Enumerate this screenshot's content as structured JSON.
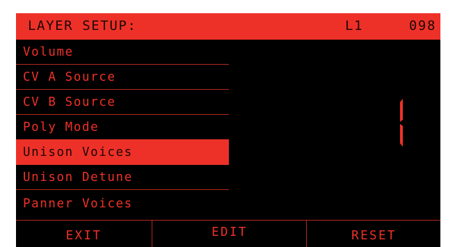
{
  "header": {
    "title": "LAYER SETUP:",
    "layer": "L1",
    "number": "098"
  },
  "menu": {
    "items": [
      {
        "label": "Volume"
      },
      {
        "label": "CV A Source"
      },
      {
        "label": "CV B Source"
      },
      {
        "label": "Poly Mode"
      },
      {
        "label": "Unison Voices"
      },
      {
        "label": "Unison Detune"
      },
      {
        "label": "Panner Voices"
      }
    ],
    "selected_index": 4
  },
  "value_display": {
    "value": "1"
  },
  "softkeys": {
    "exit": "EXIT",
    "edit": "EDIT",
    "reset": "RESET"
  },
  "colors": {
    "accent": "#ee3128",
    "background": "#000000",
    "divider": "#b5281f",
    "dark_text": "#1a0605"
  }
}
